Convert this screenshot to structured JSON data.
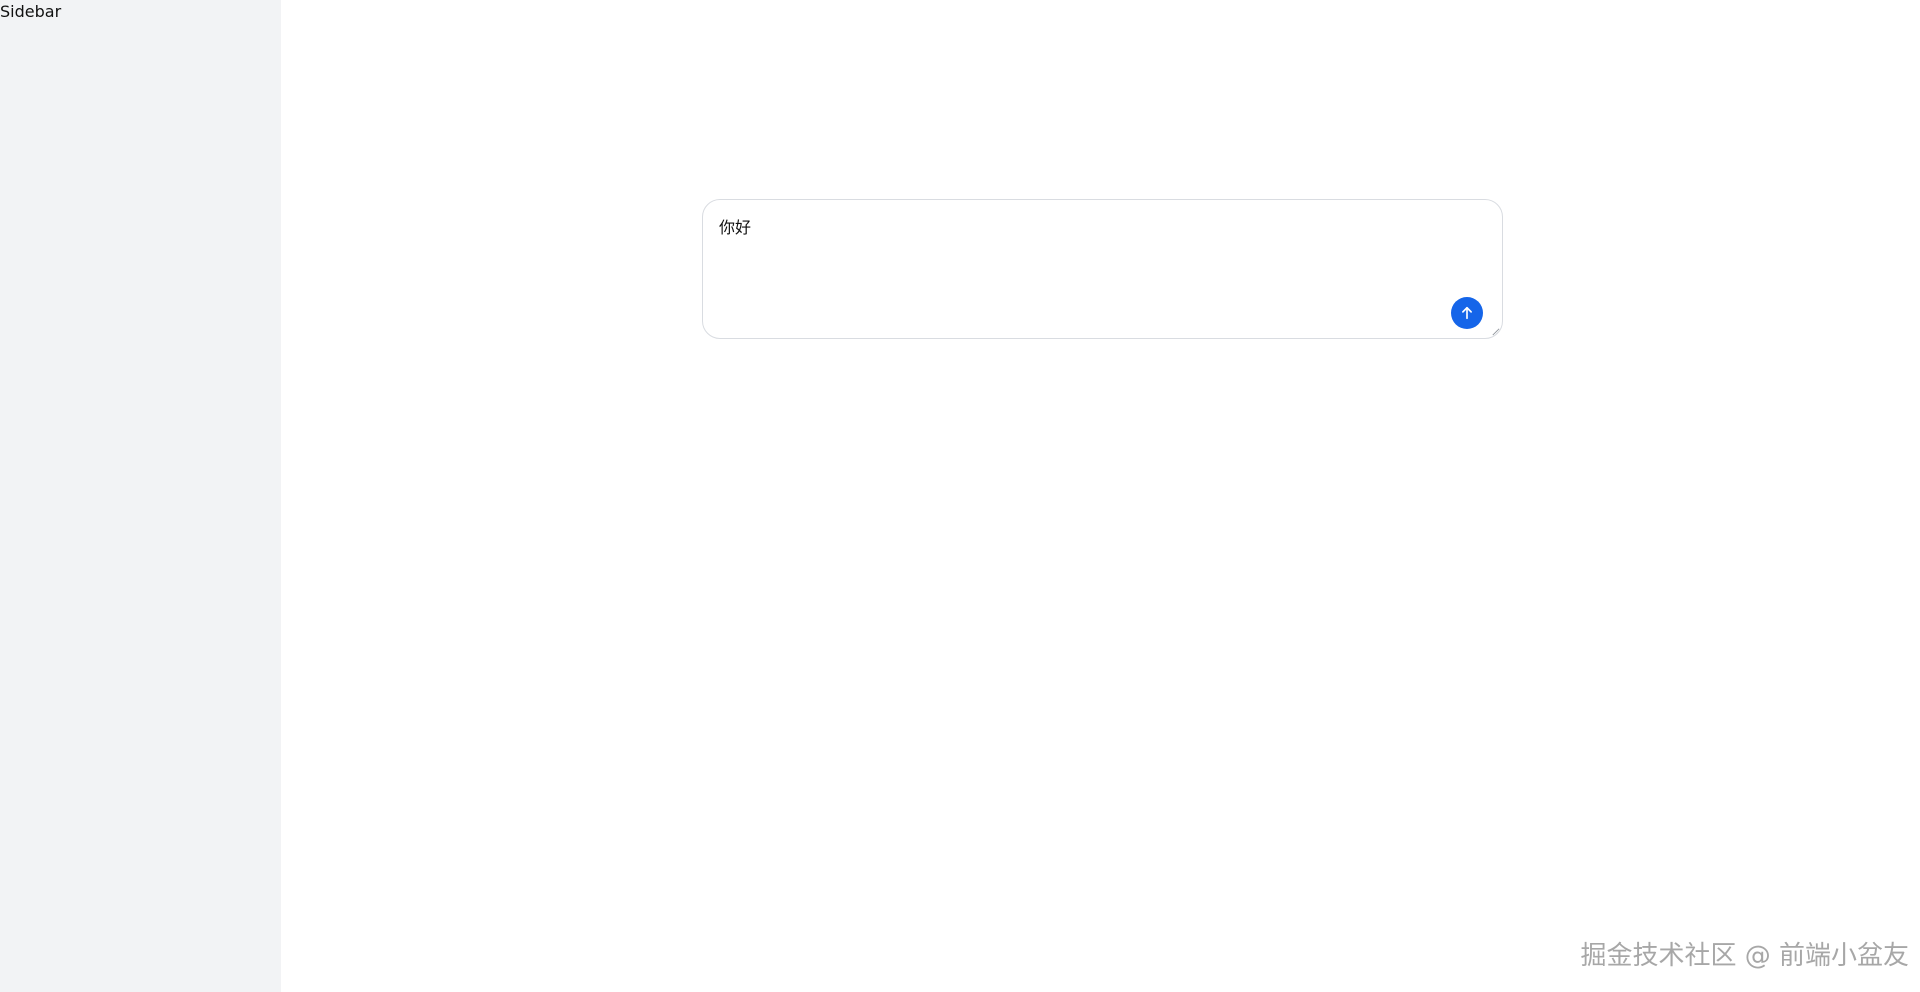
{
  "sidebar": {
    "title": "Sidebar"
  },
  "composer": {
    "value": "你好",
    "send_button_label": "send"
  },
  "watermark": {
    "text": "掘金技术社区 @ 前端小盆友"
  },
  "icons": {
    "send": "arrow-up-icon",
    "resize": "resize-handle-icon"
  },
  "colors": {
    "sidebar_background": "#f2f3f5",
    "accent": "#1565e9",
    "border": "#d9dce1"
  }
}
